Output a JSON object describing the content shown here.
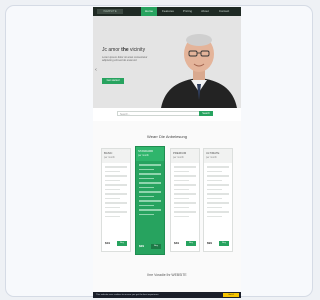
{
  "nav": {
    "brand": "WEBSITE",
    "items": [
      "Home",
      "Features",
      "Pricing",
      "About",
      "Contact"
    ]
  },
  "hero": {
    "title_pre": "Jc amor",
    "title_bold": "the",
    "title_post": " vicinity",
    "subtitle": "Lorem ipsum dolor sit amet consectetur adipiscing elit sed do eiusmod",
    "cta": "Get started",
    "prev": "‹",
    "next": "›"
  },
  "search": {
    "placeholder": "Search...",
    "button": "Search"
  },
  "plans": {
    "title": "Wearr Die Anbelesung",
    "items": [
      {
        "name": "BASIC",
        "price_note": "per month",
        "amount": "$19",
        "button": "Buy"
      },
      {
        "name": "STANDARD",
        "price_note": "per month",
        "amount": "$29",
        "button": "Buy"
      },
      {
        "name": "PREMIUM",
        "price_note": "per month",
        "amount": "$49",
        "button": "Buy"
      },
      {
        "name": "ULTIMATE",
        "price_note": "per month",
        "amount": "$99",
        "button": "Buy"
      }
    ]
  },
  "bottom": {
    "title": "Ihre Voradie Ihr WEBSITE",
    "cookie_text": "This website uses cookies to ensure you get the best experience",
    "cookie_button": "Got it!"
  },
  "colors": {
    "accent": "#27a35f",
    "nav_bg": "#1f2a24",
    "cookie_btn": "#f5c400"
  }
}
